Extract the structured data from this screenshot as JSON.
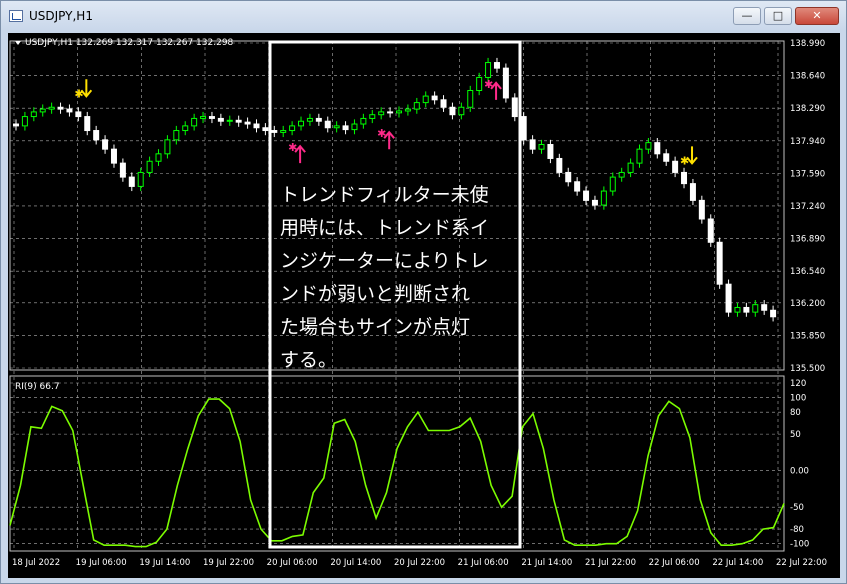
{
  "window": {
    "title": "USDJPY,H1"
  },
  "chart_header": "USDJPY,H1  132.269 132.317 132.267 132.298",
  "indicator_header": "RI(9) 66.7",
  "annotation_lines": [
    "トレンドフィルター未使",
    "用時には、トレンド系イ",
    "ンジケーターによりトレ",
    "ンドが弱いと判断され",
    "た場合もサインが点灯",
    "する。"
  ],
  "price_axis": [
    "138.990",
    "138.640",
    "138.290",
    "137.940",
    "137.590",
    "137.240",
    "136.890",
    "136.540",
    "136.200",
    "135.850",
    "135.500"
  ],
  "osc_axis": [
    "120",
    "100",
    "80",
    "50",
    "0.00",
    "-50",
    "-80",
    "-100"
  ],
  "time_axis": [
    "18 Jul 2022",
    "19 Jul 06:00",
    "19 Jul 14:00",
    "19 Jul 22:00",
    "20 Jul 06:00",
    "20 Jul 14:00",
    "20 Jul 22:00",
    "21 Jul 06:00",
    "21 Jul 14:00",
    "21 Jul 22:00",
    "22 Jul 06:00",
    "22 Jul 14:00",
    "22 Jul 22:00"
  ],
  "colors": {
    "bull": "#00ff00",
    "bear": "#ffffff",
    "osc": "#7cfc00",
    "buy_arrow": "#ff2a8a",
    "sell_arrow": "#ffe000",
    "highlight": "#ffffff",
    "grid": "#b0b0b0"
  },
  "chart_data": {
    "type": "candlestick",
    "symbol": "USDJPY",
    "timeframe": "H1",
    "price_range": [
      135.5,
      138.99
    ],
    "closes": [
      138.1,
      138.2,
      138.25,
      138.28,
      138.3,
      138.28,
      138.25,
      138.2,
      138.05,
      137.95,
      137.85,
      137.7,
      137.55,
      137.45,
      137.6,
      137.72,
      137.8,
      137.95,
      138.05,
      138.1,
      138.18,
      138.2,
      138.18,
      138.15,
      138.16,
      138.14,
      138.12,
      138.08,
      138.05,
      138.03,
      138.05,
      138.1,
      138.15,
      138.18,
      138.15,
      138.08,
      138.1,
      138.06,
      138.12,
      138.18,
      138.22,
      138.25,
      138.24,
      138.26,
      138.28,
      138.35,
      138.42,
      138.38,
      138.3,
      138.22,
      138.3,
      138.48,
      138.62,
      138.78,
      138.72,
      138.4,
      138.2,
      137.95,
      137.85,
      137.9,
      137.75,
      137.6,
      137.5,
      137.4,
      137.3,
      137.25,
      137.4,
      137.55,
      137.6,
      137.7,
      137.85,
      137.92,
      137.8,
      137.72,
      137.6,
      137.48,
      137.3,
      137.1,
      136.85,
      136.4,
      136.1,
      136.15,
      136.1,
      136.18,
      136.12,
      136.05
    ],
    "indicator": {
      "name": "RI(9)",
      "last_value": 66.7,
      "range": [
        -110,
        120
      ],
      "values": [
        -75,
        -20,
        60,
        58,
        88,
        82,
        55,
        -20,
        -95,
        -102,
        -102,
        -102,
        -104,
        -104,
        -98,
        -80,
        -20,
        30,
        75,
        98,
        98,
        85,
        40,
        -40,
        -80,
        -96,
        -96,
        -90,
        -88,
        -30,
        -10,
        65,
        70,
        40,
        -20,
        -65,
        -30,
        30,
        60,
        80,
        55,
        55,
        55,
        60,
        72,
        40,
        -20,
        -50,
        -35,
        60,
        78,
        30,
        -40,
        -95,
        -102,
        -102,
        -102,
        -100,
        -100,
        -90,
        -55,
        20,
        75,
        95,
        85,
        45,
        -40,
        -85,
        -102,
        -102,
        -100,
        -95,
        -80,
        -78,
        -45
      ],
      "levels": [
        80,
        50,
        -50,
        -80
      ]
    },
    "signals": [
      {
        "type": "sell",
        "bar": "19 Jul 02:00"
      },
      {
        "type": "buy",
        "bar": "20 Jul 06:00"
      },
      {
        "type": "buy",
        "bar": "20 Jul 14:00"
      },
      {
        "type": "buy",
        "bar": "21 Jul 06:00"
      },
      {
        "type": "sell",
        "bar": "22 Jul 06:00"
      }
    ]
  }
}
